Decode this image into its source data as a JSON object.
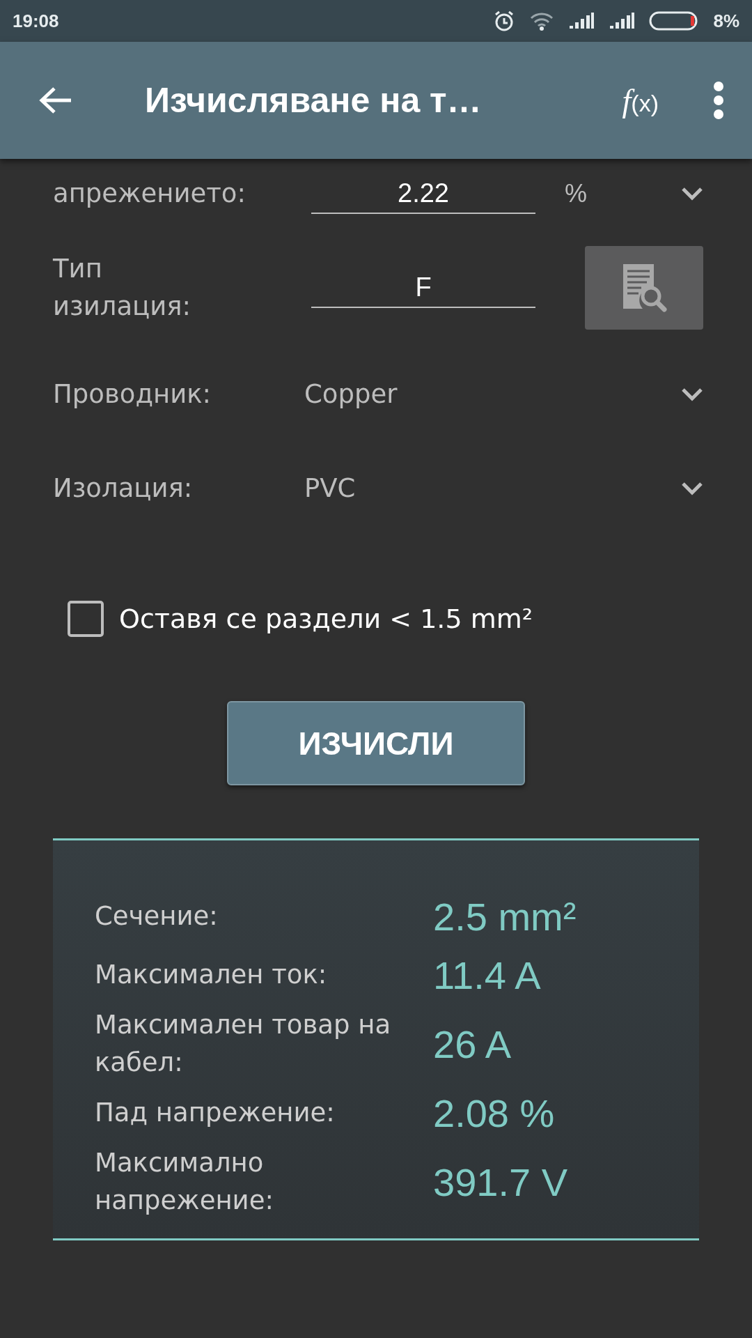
{
  "status_bar": {
    "time": "19:08",
    "battery": "8%"
  },
  "toolbar": {
    "title": "Изчисляване на т…",
    "formula_label": "f",
    "formula_arg": "(x)"
  },
  "form": [
    {
      "kind": "input",
      "label_lines": [
        "апрежението:"
      ],
      "value": "2.22",
      "unit": "%"
    },
    {
      "kind": "lookup",
      "label_lines": [
        "Тип",
        "изилация:"
      ],
      "value": "F"
    },
    {
      "kind": "select",
      "label_lines": [
        "Проводник:"
      ],
      "value": "Copper"
    },
    {
      "kind": "select",
      "label_lines": [
        "Изолация:"
      ],
      "value": "PVC"
    }
  ],
  "checkbox": {
    "label": "Оставя се раздели < 1.5 mm²",
    "checked": false
  },
  "calculate_button": "ИЗЧИСЛИ",
  "results": [
    {
      "label": "Сечение:",
      "value": "2.5 mm²"
    },
    {
      "label": "Максимален ток:",
      "value": "11.4 A"
    },
    {
      "label": "Максимален товар на кабел:",
      "value": "26 A"
    },
    {
      "label": "Пад напрежение:",
      "value": "2.08 %"
    },
    {
      "label": "Максимално напрежение:",
      "value": "391.7 V"
    }
  ]
}
